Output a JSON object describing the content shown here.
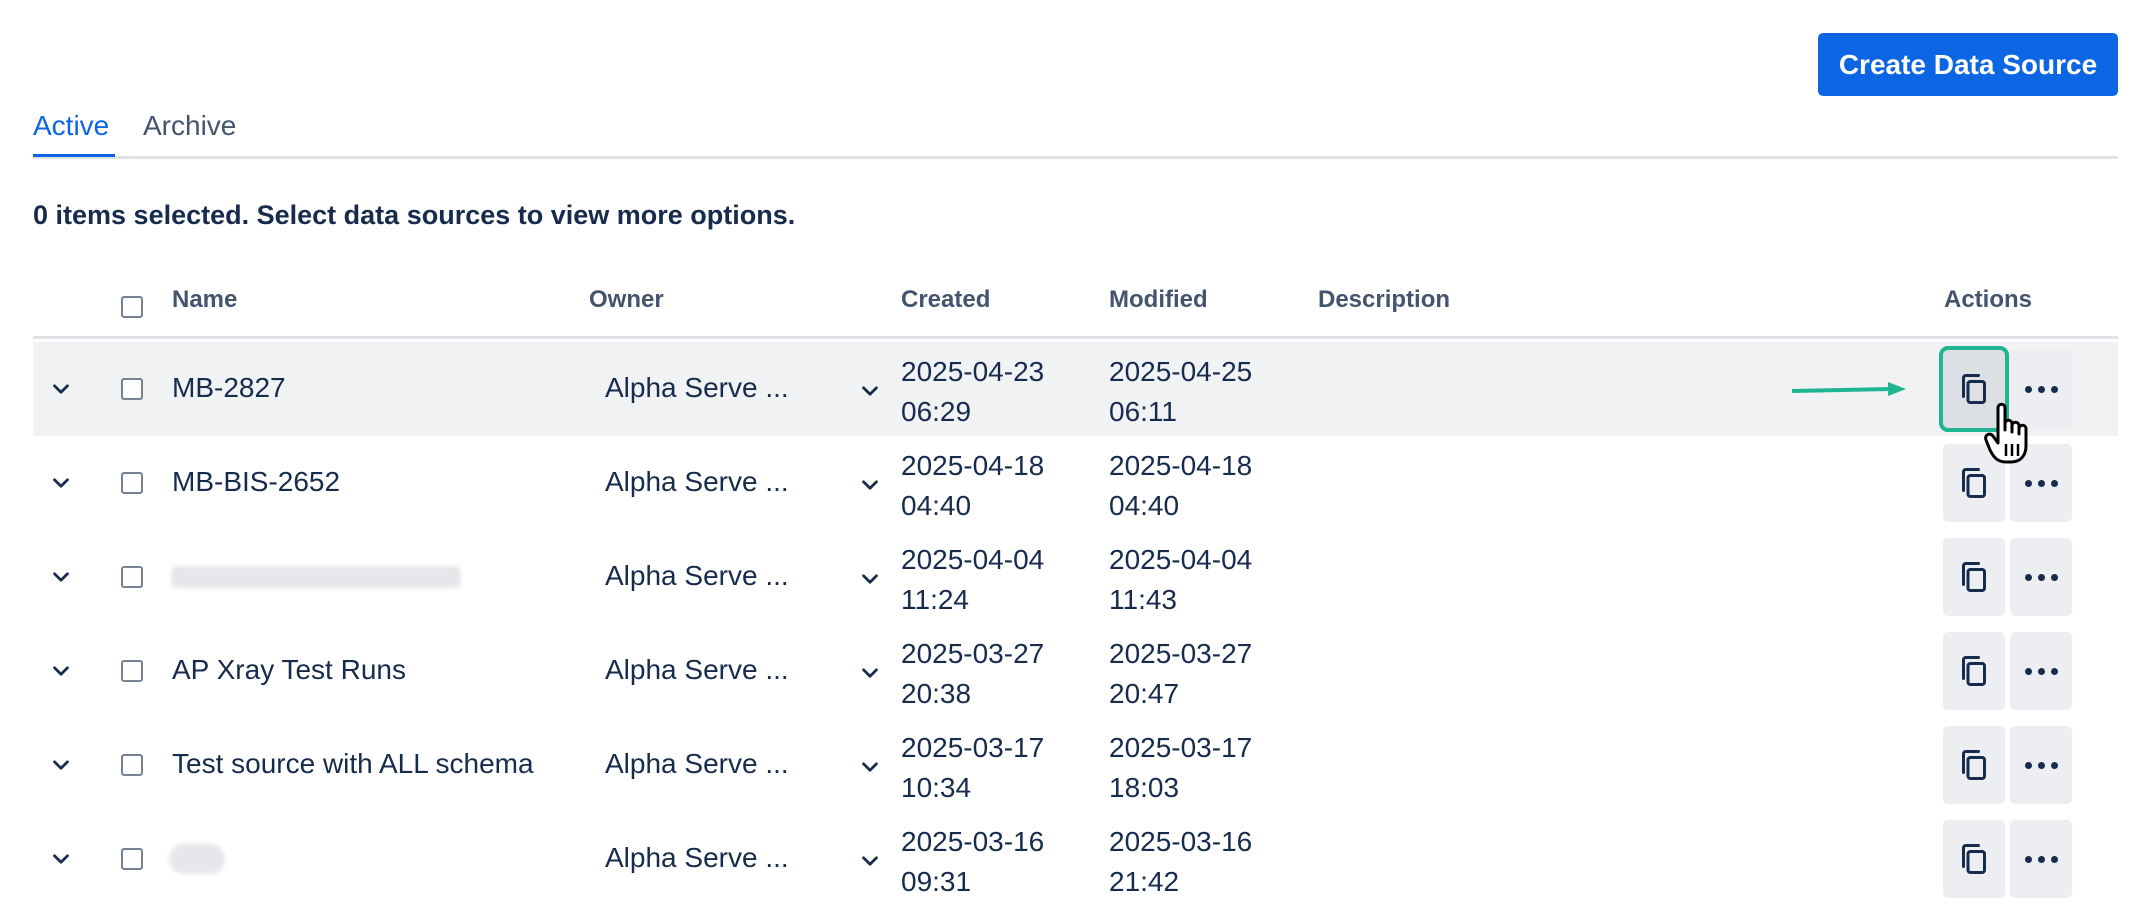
{
  "header": {
    "create_button_label": "Create Data Source"
  },
  "tabs": [
    {
      "label": "Active"
    },
    {
      "label": "Archive"
    }
  ],
  "selection_text": "0 items selected. Select data sources to view more options.",
  "table": {
    "columns": {
      "name": "Name",
      "owner": "Owner",
      "created": "Created",
      "modified": "Modified",
      "description": "Description",
      "actions": "Actions"
    },
    "rows": [
      {
        "name": "MB-2827",
        "owner": "Alpha Serve ...",
        "created_date": "2025-04-23",
        "created_time": "06:29",
        "modified_date": "2025-04-25",
        "modified_time": "06:11",
        "description": ""
      },
      {
        "name": "MB-BIS-2652",
        "owner": "Alpha Serve ...",
        "created_date": "2025-04-18",
        "created_time": "04:40",
        "modified_date": "2025-04-18",
        "modified_time": "04:40",
        "description": ""
      },
      {
        "name": "",
        "owner": "Alpha Serve ...",
        "created_date": "2025-04-04",
        "created_time": "11:24",
        "modified_date": "2025-04-04",
        "modified_time": "11:43",
        "description": ""
      },
      {
        "name": "AP Xray Test Runs",
        "owner": "Alpha Serve ...",
        "created_date": "2025-03-27",
        "created_time": "20:38",
        "modified_date": "2025-03-27",
        "modified_time": "20:47",
        "description": ""
      },
      {
        "name": "Test source with ALL schema",
        "owner": "Alpha Serve ...",
        "created_date": "2025-03-17",
        "created_time": "10:34",
        "modified_date": "2025-03-17",
        "modified_time": "18:03",
        "description": ""
      },
      {
        "name": "",
        "owner": "Alpha Serve ...",
        "created_date": "2025-03-16",
        "created_time": "09:31",
        "modified_date": "2025-03-16",
        "modified_time": "21:42",
        "description": ""
      }
    ]
  },
  "icons": {
    "expand": "chevron-down-icon",
    "owner_dropdown": "chevron-down-icon",
    "copy": "copy-icon",
    "more": "more-horizontal-icon"
  },
  "colors": {
    "accent": "#0c66e4",
    "highlight_border": "#1fb492",
    "text": "#172b4d",
    "header_text": "#44546f"
  }
}
